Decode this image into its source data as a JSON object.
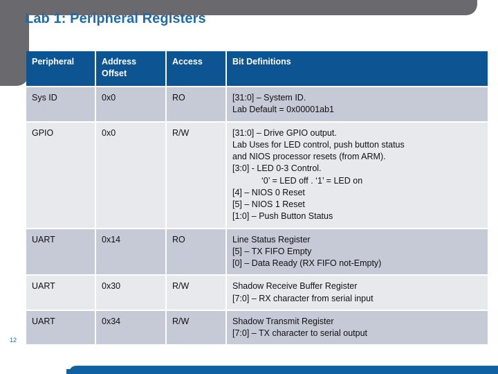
{
  "slide": {
    "title": "Lab 1: Peripheral Registers",
    "page_number": "12",
    "accent_color": "#1f6aa8",
    "header_color": "#0d5493",
    "frame_color": "#6a6a6e",
    "banner_color": "#1061a4",
    "row_shade_a": "#c5cad6",
    "row_shade_b": "#e8e9ec"
  },
  "table": {
    "columns": [
      "Peripheral",
      "Address Offset",
      "Access",
      "Bit Definitions"
    ],
    "rows": [
      {
        "peripheral": "Sys ID",
        "offset": "0x0",
        "access": "RO",
        "bits": [
          {
            "text": "[31:0] – System ID.",
            "indent": false
          },
          {
            "text": "Lab Default = 0x00001ab1",
            "indent": false
          }
        ]
      },
      {
        "peripheral": "GPIO",
        "offset": "0x0",
        "access": "R/W",
        "bits": [
          {
            "text": "[31:0] – Drive GPIO output.",
            "indent": false
          },
          {
            "text": "Lab Uses for LED control, push button status",
            "indent": false
          },
          {
            "text": "and NIOS processor resets (from ARM).",
            "indent": false
          },
          {
            "text": "[3:0] - LED 0-3 Control.",
            "indent": false
          },
          {
            "text": "‘0’ = LED off . ‘1’ = LED on",
            "indent": true
          },
          {
            "text": "[4] – NIOS 0 Reset",
            "indent": false
          },
          {
            "text": "[5] – NIOS 1 Reset",
            "indent": false
          },
          {
            "text": "[1:0] – Push Button Status",
            "indent": false
          }
        ]
      },
      {
        "peripheral": "UART",
        "offset": "0x14",
        "access": "RO",
        "bits": [
          {
            "text": "Line Status Register",
            "indent": false
          },
          {
            "text": "[5] – TX FIFO Empty",
            "indent": false
          },
          {
            "text": "[0] – Data Ready (RX FIFO not-Empty)",
            "indent": false
          }
        ]
      },
      {
        "peripheral": "UART",
        "offset": "0x30",
        "access": "R/W",
        "bits": [
          {
            "text": "Shadow Receive Buffer Register",
            "indent": false
          },
          {
            "text": "[7:0] – RX character from serial input",
            "indent": false
          }
        ]
      },
      {
        "peripheral": "UART",
        "offset": "0x34",
        "access": "R/W",
        "bits": [
          {
            "text": "Shadow Transmit Register",
            "indent": false
          },
          {
            "text": "[7:0] – TX character to serial output",
            "indent": false
          }
        ]
      }
    ]
  }
}
